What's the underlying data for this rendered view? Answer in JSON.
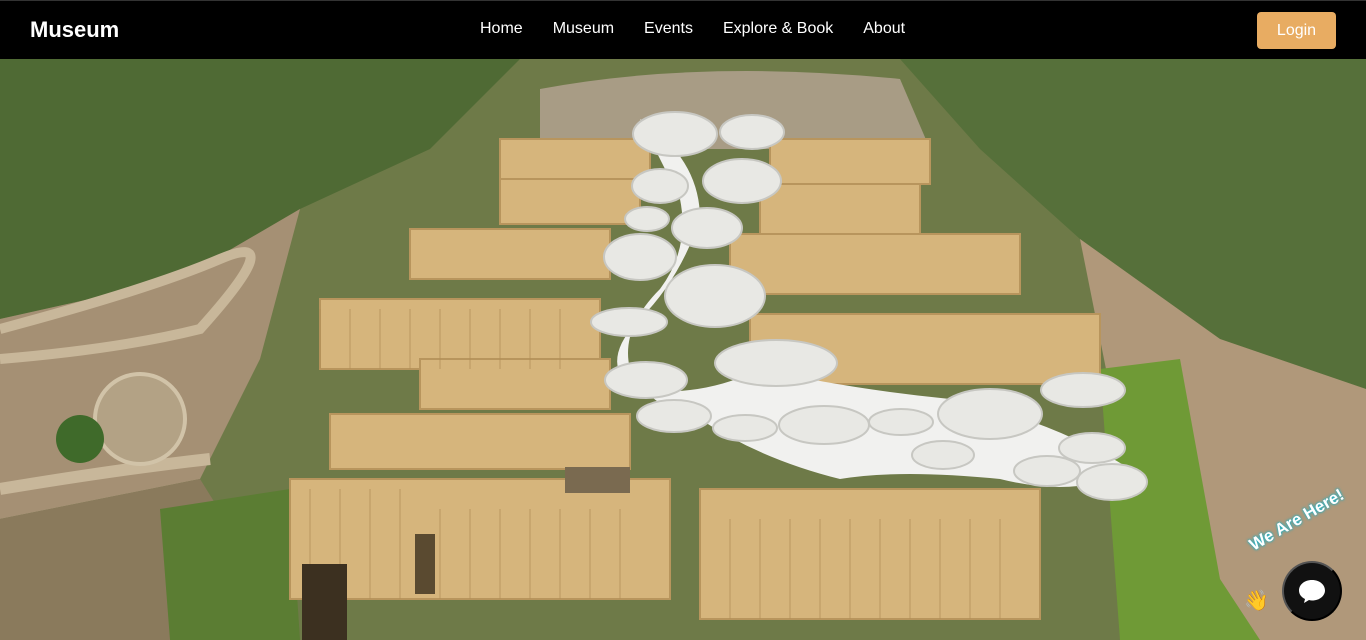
{
  "header": {
    "brand": "Museum",
    "nav": [
      "Home",
      "Museum",
      "Events",
      "Explore & Book",
      "About"
    ],
    "login_label": "Login"
  },
  "hero": {
    "image": "aerial-museum-architecture"
  },
  "chat": {
    "label": "We Are Here!",
    "icon": "chat-bubble-icon",
    "wave_icon": "waving-hand-icon"
  },
  "colors": {
    "accent": "#e8ac62",
    "nav_bg": "#000000"
  }
}
